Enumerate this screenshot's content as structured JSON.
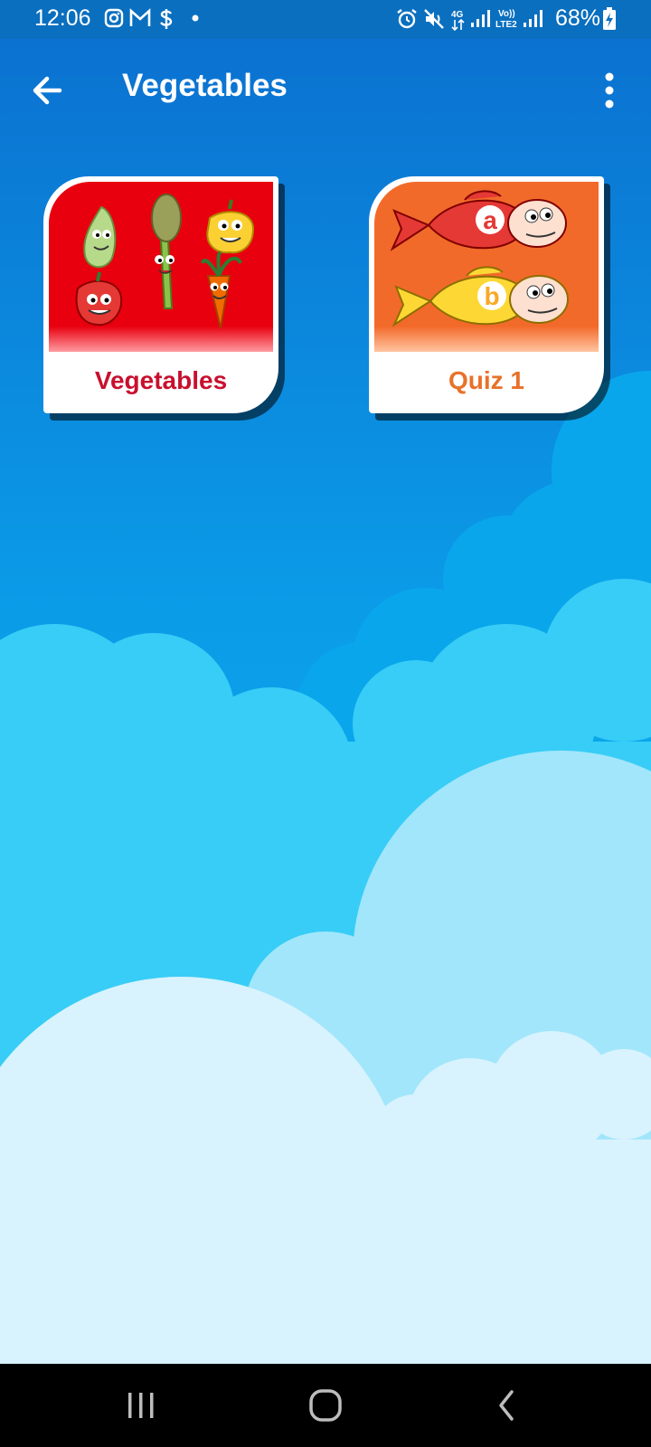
{
  "status_bar": {
    "time": "12:06",
    "battery_percent": "68%",
    "left_icons": [
      "instagram-icon",
      "gmail-icon",
      "dollar-icon",
      "dot-icon"
    ],
    "right_icons": [
      "alarm-icon",
      "mute-icon",
      "4g-data-icon",
      "signal-icon",
      "volte-lte2-icon",
      "signal-icon",
      "battery-charging-icon"
    ]
  },
  "app_bar": {
    "title": "Vegetables",
    "back_icon": "arrow-left-icon",
    "menu_icon": "more-vert-icon"
  },
  "cards": [
    {
      "label": "Vegetables",
      "label_color": "#c8102e",
      "bg": "#e8000f"
    },
    {
      "label": "Quiz 1",
      "label_color": "#e8712a",
      "bg": "#f26a2a",
      "fish_letters": [
        "a",
        "b"
      ]
    }
  ],
  "nav_bar": {
    "icons": [
      "recent-apps-icon",
      "home-icon",
      "back-icon"
    ]
  },
  "colors": {
    "sky_top": "#0a6fd0",
    "sky_light": "#39c8f5",
    "cloud_pale": "#d8f4fd"
  }
}
